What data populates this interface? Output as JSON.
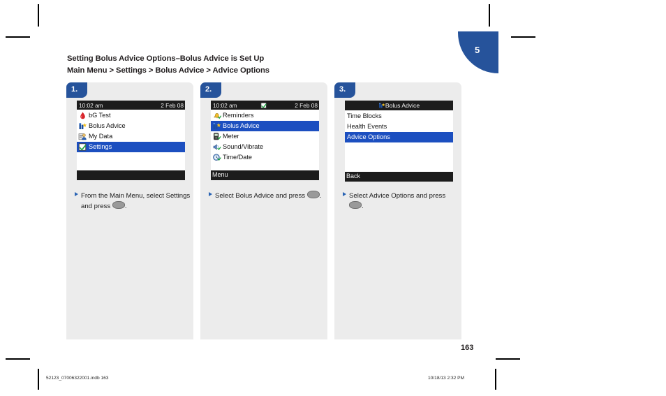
{
  "chapter_tab": {
    "number": "5"
  },
  "headings": {
    "line1": "Setting Bolus Advice Options–Bolus Advice is Set Up",
    "line2": "Main Menu > Settings > Bolus Advice > Advice Options"
  },
  "steps": [
    {
      "badge": "1.",
      "screen": {
        "type": "statusbar",
        "status": {
          "time": "10:02 am",
          "date": "2 Feb 08",
          "center_icon": ""
        },
        "rows": [
          {
            "label": "bG Test",
            "icon": "blood-drop-icon",
            "selected": false
          },
          {
            "label": "Bolus Advice",
            "icon": "bolus-advice-icon",
            "selected": false
          },
          {
            "label": "My Data",
            "icon": "my-data-icon",
            "selected": false
          },
          {
            "label": "Settings",
            "icon": "settings-check-icon",
            "selected": true
          }
        ],
        "softkey": ""
      },
      "caption_before": "From the Main Menu, select Settings and press",
      "caption_after": "."
    },
    {
      "badge": "2.",
      "screen": {
        "type": "statusbar",
        "status": {
          "time": "10:02 am",
          "date": "2 Feb 08",
          "center_icon": "green-check-icon"
        },
        "rows": [
          {
            "label": "Reminders",
            "icon": "reminders-bell-icon",
            "selected": false
          },
          {
            "label": "Bolus Advice",
            "icon": "bolus-advice-icon",
            "selected": true
          },
          {
            "label": "Meter",
            "icon": "meter-icon",
            "selected": false
          },
          {
            "label": "Sound/Vibrate",
            "icon": "sound-vibrate-icon",
            "selected": false
          },
          {
            "label": "Time/Date",
            "icon": "time-date-icon",
            "selected": false
          }
        ],
        "softkey": "Menu"
      },
      "caption_before": "Select Bolus Advice and press",
      "caption_after": "."
    },
    {
      "badge": "3.",
      "screen": {
        "type": "titlebar",
        "title": "Bolus Advice",
        "title_icon": "bolus-advice-icon",
        "rows": [
          {
            "label": "Time Blocks",
            "icon": "",
            "selected": false
          },
          {
            "label": "Health Events",
            "icon": "",
            "selected": false
          },
          {
            "label": "Advice Options",
            "icon": "",
            "selected": true
          }
        ],
        "softkey": "Back"
      },
      "caption_before": "Select Advice Options and press",
      "caption_after": "."
    }
  ],
  "page_number": "163",
  "footer": {
    "left": "52123_07006322001.indb   163",
    "right": "10/18/13   2:32 PM"
  },
  "colors": {
    "brand_blue": "#26539b",
    "selection_blue": "#1c4fc0",
    "panel_gray": "#ececec",
    "screen_black": "#1c1c1c"
  }
}
